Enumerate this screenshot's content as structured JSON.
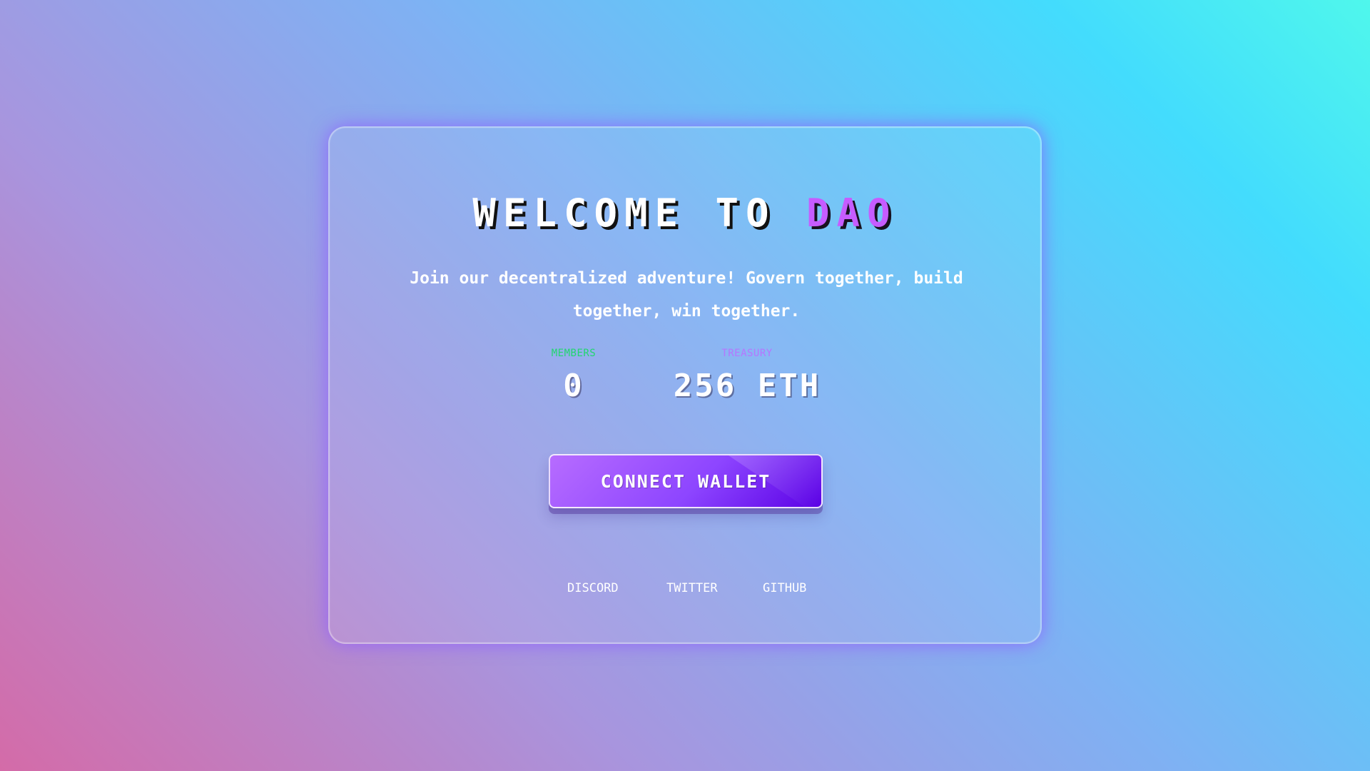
{
  "hero": {
    "title_prefix": "WELCOME TO ",
    "title_accent": "DAO",
    "subtitle": "Join our decentralized adventure! Govern together, build together, win together."
  },
  "stats": {
    "members": {
      "label": "MEMBERS",
      "value": "0"
    },
    "treasury": {
      "label": "TREASURY",
      "value": "256 ETH"
    }
  },
  "cta": {
    "connect_wallet": "CONNECT WALLET"
  },
  "footer": {
    "links": [
      {
        "label": "DISCORD"
      },
      {
        "label": "TWITTER"
      },
      {
        "label": "GITHUB"
      }
    ]
  },
  "colors": {
    "background_pink": "#d46ba8",
    "background_purple": "#a895de",
    "background_blue": "#7fb1f3",
    "background_cyan": "#43dcfd",
    "accent_purple": "#c65cff",
    "members_label": "#21d66f",
    "treasury_label": "#b576ff",
    "button_start": "#b76cff",
    "button_end": "#5a00e5"
  }
}
